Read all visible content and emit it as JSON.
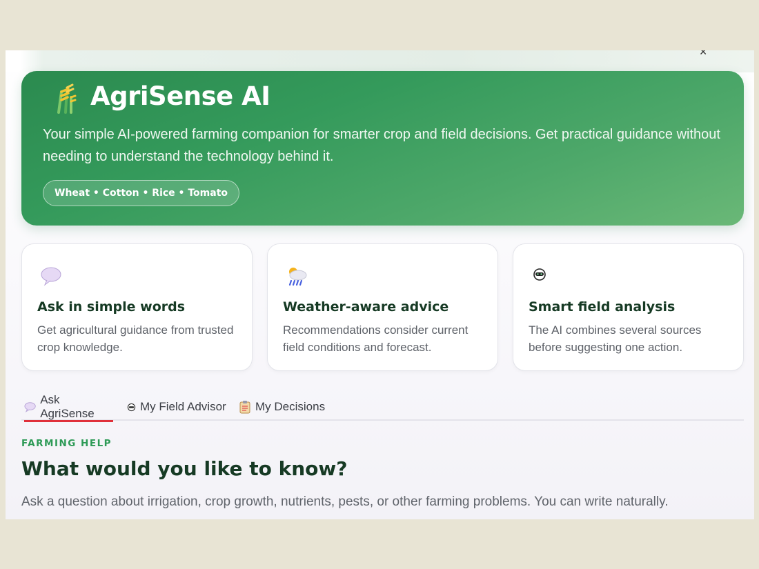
{
  "hero": {
    "title": "AgriSense AI",
    "description": "Your simple AI-powered farming companion for smarter crop and field decisions. Get practical guidance without needing to understand the technology behind it.",
    "crops": "Wheat • Cotton • Rice • Tomato"
  },
  "features": [
    {
      "icon": "speech-bubble-icon",
      "title": "Ask in simple words",
      "text": "Get agricultural guidance from trusted crop knowledge."
    },
    {
      "icon": "weather-icon",
      "title": "Weather-aware advice",
      "text": "Recommendations consider current field conditions and forecast."
    },
    {
      "icon": "robot-icon",
      "title": "Smart field analysis",
      "text": "The AI combines several sources before suggesting one action."
    }
  ],
  "tabs": [
    {
      "label": "Ask AgriSense",
      "icon": "speech-bubble-icon",
      "active": true
    },
    {
      "label": "My Field Advisor",
      "icon": "robot-icon",
      "active": false
    },
    {
      "label": "My Decisions",
      "icon": "clipboard-icon",
      "active": false
    }
  ],
  "section": {
    "eyebrow": "FARMING HELP",
    "title": "What would you like to know?",
    "description": "Ask a question about irrigation, crop growth, nutrients, pests, or other farming problems. You can write naturally."
  },
  "colors": {
    "accent": "#2b8a4f",
    "tab_active": "#e0303a",
    "heading": "#163a24"
  }
}
